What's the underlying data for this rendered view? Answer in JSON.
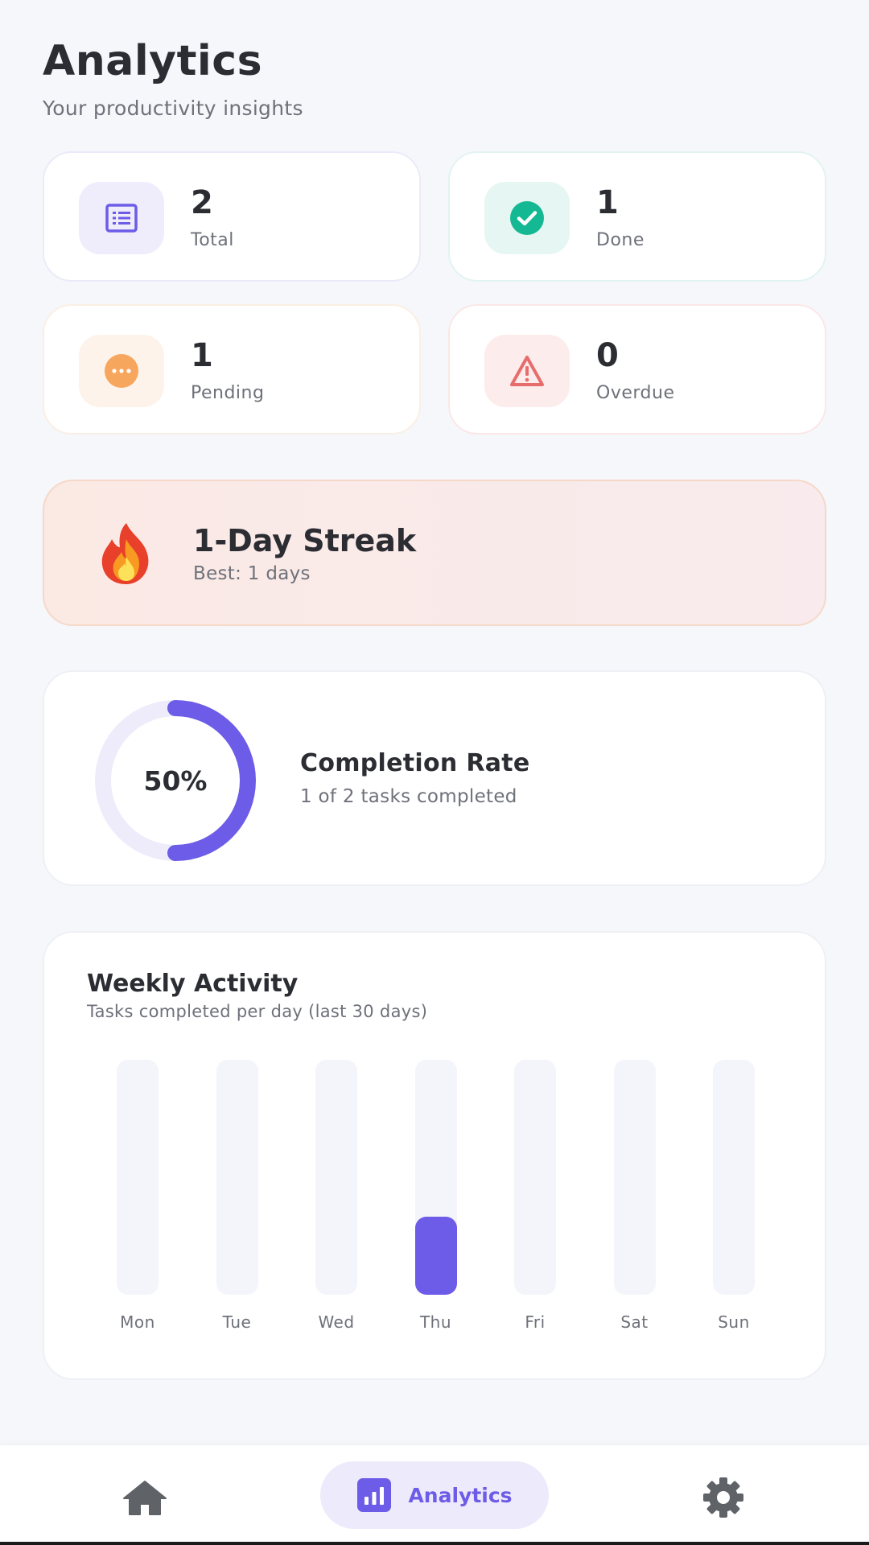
{
  "header": {
    "title": "Analytics",
    "subtitle": "Your productivity insights"
  },
  "stats": [
    {
      "value": "2",
      "label": "Total",
      "icon": "list-icon",
      "color": "#6c5ce7",
      "bg": "#efedfc"
    },
    {
      "value": "1",
      "label": "Done",
      "icon": "check-circle-icon",
      "color": "#14b892",
      "bg": "#e6f7f3"
    },
    {
      "value": "1",
      "label": "Pending",
      "icon": "more-circle-icon",
      "color": "#f7a65e",
      "bg": "#fef3ea"
    },
    {
      "value": "0",
      "label": "Overdue",
      "icon": "warning-icon",
      "color": "#e76d6d",
      "bg": "#fdecec"
    }
  ],
  "streak": {
    "icon": "fire-icon",
    "title": "1-Day Streak",
    "best": "Best: 1 days"
  },
  "completion": {
    "percent_label": "50%",
    "percent": 0.5,
    "title": "Completion Rate",
    "subtitle": "1 of 2 tasks completed",
    "color": "#6c5ce7",
    "track_color": "#eeecfb"
  },
  "weekly": {
    "title": "Weekly Activity",
    "subtitle": "Tasks completed per day (last 30 days)",
    "chart_data": {
      "type": "bar",
      "categories": [
        "Mon",
        "Tue",
        "Wed",
        "Thu",
        "Fri",
        "Sat",
        "Sun"
      ],
      "values": [
        0,
        0,
        0,
        1,
        0,
        0,
        0
      ],
      "ylim": [
        0,
        3
      ],
      "color": "#6c5ce7"
    }
  },
  "nav": {
    "home_icon": "home-icon",
    "analytics_icon": "bar-chart-icon",
    "analytics_label": "Analytics",
    "settings_icon": "gear-icon"
  },
  "colors": {
    "accent": "#6c5ce7",
    "background": "#f6f7fb"
  }
}
